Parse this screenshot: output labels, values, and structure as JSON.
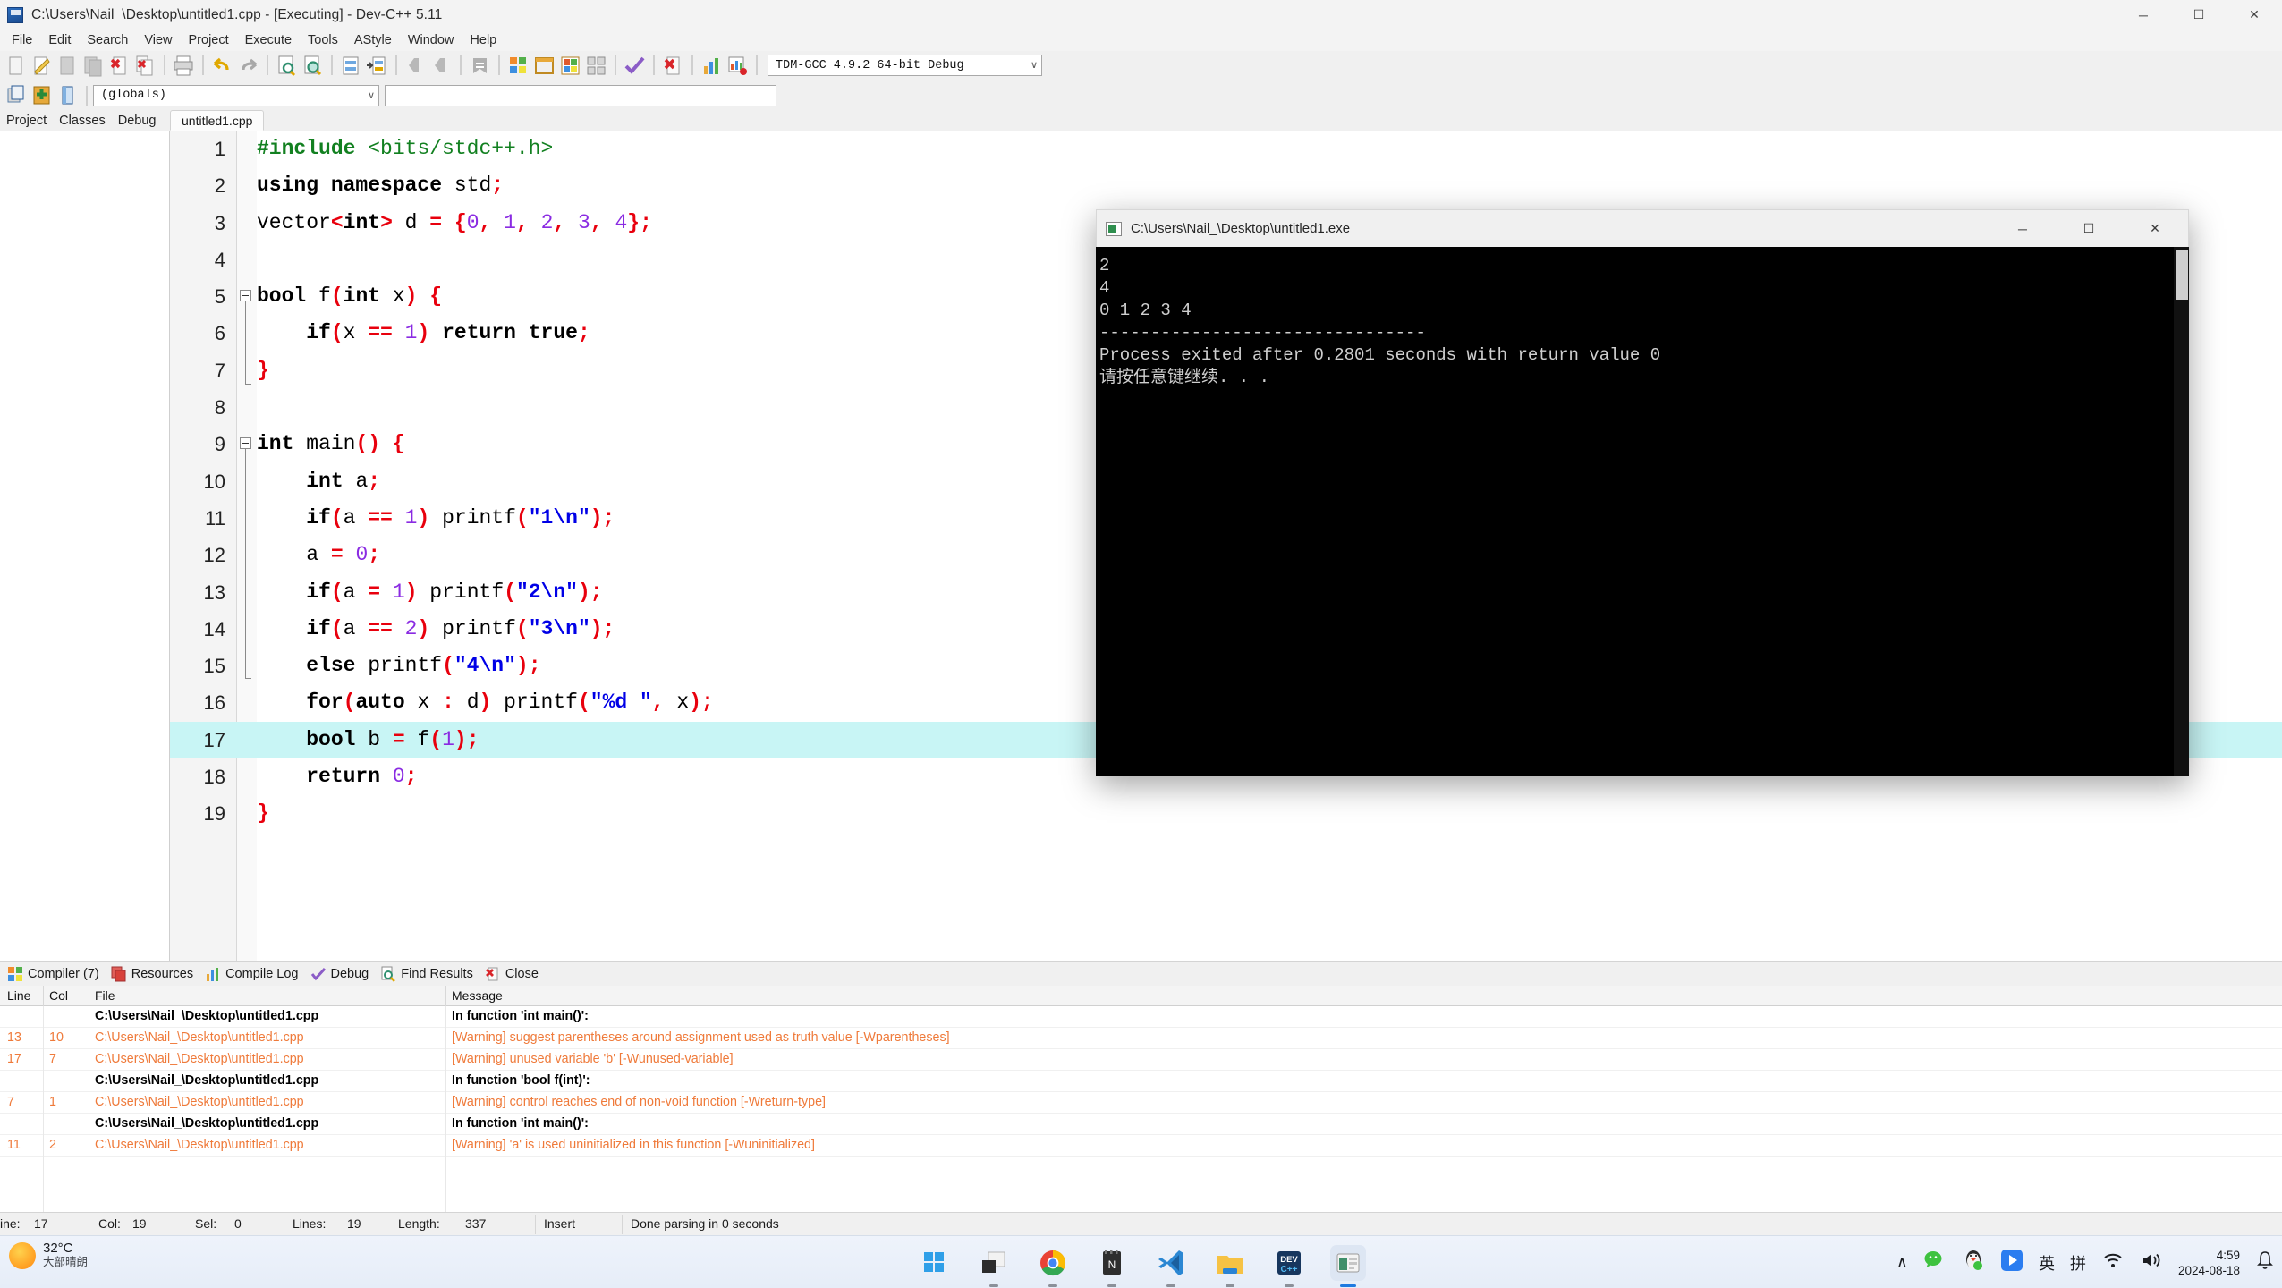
{
  "window": {
    "title": "C:\\Users\\Nail_\\Desktop\\untitled1.cpp - [Executing] - Dev-C++ 5.11",
    "minimize": "─",
    "maximize": "☐",
    "close": "✕"
  },
  "menu": [
    {
      "label": "File"
    },
    {
      "label": "Edit"
    },
    {
      "label": "Search"
    },
    {
      "label": "View"
    },
    {
      "label": "Project"
    },
    {
      "label": "Execute"
    },
    {
      "label": "Tools"
    },
    {
      "label": "AStyle"
    },
    {
      "label": "Window"
    },
    {
      "label": "Help"
    }
  ],
  "toolbar": {
    "compiler_set": "TDM-GCC 4.9.2 64-bit Debug",
    "chevron": "∨",
    "scope": "(globals)"
  },
  "left_panel": {
    "tabs": [
      "Project",
      "Classes",
      "Debug"
    ]
  },
  "editor": {
    "file_tab": "untitled1.cpp",
    "active_line": 17,
    "lines": [
      {
        "n": 1,
        "tokens": [
          {
            "t": "#include",
            "c": "pp"
          },
          {
            "t": " ",
            "c": "id"
          },
          {
            "t": "<bits/stdc++.h>",
            "c": "ppv"
          }
        ]
      },
      {
        "n": 2,
        "tokens": [
          {
            "t": "using namespace",
            "c": "k"
          },
          {
            "t": " std",
            "c": "id"
          },
          {
            "t": ";",
            "c": "op"
          }
        ]
      },
      {
        "n": 3,
        "tokens": [
          {
            "t": "vector",
            "c": "id"
          },
          {
            "t": "<",
            "c": "op"
          },
          {
            "t": "int",
            "c": "k"
          },
          {
            "t": ">",
            "c": "op"
          },
          {
            "t": " d ",
            "c": "id"
          },
          {
            "t": "=",
            "c": "op"
          },
          {
            "t": " ",
            "c": "id"
          },
          {
            "t": "{",
            "c": "op"
          },
          {
            "t": "0",
            "c": "nu"
          },
          {
            "t": ",",
            "c": "op"
          },
          {
            "t": " ",
            "c": "id"
          },
          {
            "t": "1",
            "c": "nu"
          },
          {
            "t": ",",
            "c": "op"
          },
          {
            "t": " ",
            "c": "id"
          },
          {
            "t": "2",
            "c": "nu"
          },
          {
            "t": ",",
            "c": "op"
          },
          {
            "t": " ",
            "c": "id"
          },
          {
            "t": "3",
            "c": "nu"
          },
          {
            "t": ",",
            "c": "op"
          },
          {
            "t": " ",
            "c": "id"
          },
          {
            "t": "4",
            "c": "nu"
          },
          {
            "t": "};",
            "c": "op"
          }
        ]
      },
      {
        "n": 4,
        "tokens": []
      },
      {
        "n": 5,
        "tokens": [
          {
            "t": "bool",
            "c": "k"
          },
          {
            "t": " f",
            "c": "id"
          },
          {
            "t": "(",
            "c": "op"
          },
          {
            "t": "int",
            "c": "k"
          },
          {
            "t": " x",
            "c": "id"
          },
          {
            "t": ") {",
            "c": "op"
          }
        ]
      },
      {
        "n": 6,
        "tokens": [
          {
            "t": "    ",
            "c": "id"
          },
          {
            "t": "if",
            "c": "k"
          },
          {
            "t": "(",
            "c": "op"
          },
          {
            "t": "x ",
            "c": "id"
          },
          {
            "t": "==",
            "c": "op"
          },
          {
            "t": " ",
            "c": "id"
          },
          {
            "t": "1",
            "c": "nu"
          },
          {
            "t": ")",
            "c": "op"
          },
          {
            "t": " ",
            "c": "id"
          },
          {
            "t": "return",
            "c": "k"
          },
          {
            "t": " ",
            "c": "id"
          },
          {
            "t": "true",
            "c": "k"
          },
          {
            "t": ";",
            "c": "op"
          }
        ]
      },
      {
        "n": 7,
        "tokens": [
          {
            "t": "}",
            "c": "op"
          }
        ]
      },
      {
        "n": 8,
        "tokens": []
      },
      {
        "n": 9,
        "tokens": [
          {
            "t": "int",
            "c": "k"
          },
          {
            "t": " main",
            "c": "id"
          },
          {
            "t": "() {",
            "c": "op"
          }
        ]
      },
      {
        "n": 10,
        "tokens": [
          {
            "t": "    ",
            "c": "id"
          },
          {
            "t": "int",
            "c": "k"
          },
          {
            "t": " a",
            "c": "id"
          },
          {
            "t": ";",
            "c": "op"
          }
        ]
      },
      {
        "n": 11,
        "tokens": [
          {
            "t": "    ",
            "c": "id"
          },
          {
            "t": "if",
            "c": "k"
          },
          {
            "t": "(",
            "c": "op"
          },
          {
            "t": "a ",
            "c": "id"
          },
          {
            "t": "==",
            "c": "op"
          },
          {
            "t": " ",
            "c": "id"
          },
          {
            "t": "1",
            "c": "nu"
          },
          {
            "t": ")",
            "c": "op"
          },
          {
            "t": " printf",
            "c": "id"
          },
          {
            "t": "(",
            "c": "op"
          },
          {
            "t": "\"1\\n\"",
            "c": "st"
          },
          {
            "t": ");",
            "c": "op"
          }
        ]
      },
      {
        "n": 12,
        "tokens": [
          {
            "t": "    a ",
            "c": "id"
          },
          {
            "t": "=",
            "c": "op"
          },
          {
            "t": " ",
            "c": "id"
          },
          {
            "t": "0",
            "c": "nu"
          },
          {
            "t": ";",
            "c": "op"
          }
        ]
      },
      {
        "n": 13,
        "tokens": [
          {
            "t": "    ",
            "c": "id"
          },
          {
            "t": "if",
            "c": "k"
          },
          {
            "t": "(",
            "c": "op"
          },
          {
            "t": "a ",
            "c": "id"
          },
          {
            "t": "=",
            "c": "op"
          },
          {
            "t": " ",
            "c": "id"
          },
          {
            "t": "1",
            "c": "nu"
          },
          {
            "t": ")",
            "c": "op"
          },
          {
            "t": " printf",
            "c": "id"
          },
          {
            "t": "(",
            "c": "op"
          },
          {
            "t": "\"2\\n\"",
            "c": "st"
          },
          {
            "t": ");",
            "c": "op"
          }
        ]
      },
      {
        "n": 14,
        "tokens": [
          {
            "t": "    ",
            "c": "id"
          },
          {
            "t": "if",
            "c": "k"
          },
          {
            "t": "(",
            "c": "op"
          },
          {
            "t": "a ",
            "c": "id"
          },
          {
            "t": "==",
            "c": "op"
          },
          {
            "t": " ",
            "c": "id"
          },
          {
            "t": "2",
            "c": "nu"
          },
          {
            "t": ")",
            "c": "op"
          },
          {
            "t": " printf",
            "c": "id"
          },
          {
            "t": "(",
            "c": "op"
          },
          {
            "t": "\"3\\n\"",
            "c": "st"
          },
          {
            "t": ");",
            "c": "op"
          }
        ]
      },
      {
        "n": 15,
        "tokens": [
          {
            "t": "    ",
            "c": "id"
          },
          {
            "t": "else",
            "c": "k"
          },
          {
            "t": " printf",
            "c": "id"
          },
          {
            "t": "(",
            "c": "op"
          },
          {
            "t": "\"4\\n\"",
            "c": "st"
          },
          {
            "t": ");",
            "c": "op"
          }
        ]
      },
      {
        "n": 16,
        "tokens": [
          {
            "t": "    ",
            "c": "id"
          },
          {
            "t": "for",
            "c": "k"
          },
          {
            "t": "(",
            "c": "op"
          },
          {
            "t": "auto",
            "c": "k"
          },
          {
            "t": " x ",
            "c": "id"
          },
          {
            "t": ":",
            "c": "op"
          },
          {
            "t": " d",
            "c": "id"
          },
          {
            "t": ")",
            "c": "op"
          },
          {
            "t": " printf",
            "c": "id"
          },
          {
            "t": "(",
            "c": "op"
          },
          {
            "t": "\"%d \"",
            "c": "st"
          },
          {
            "t": ",",
            "c": "op"
          },
          {
            "t": " x",
            "c": "id"
          },
          {
            "t": ");",
            "c": "op"
          }
        ]
      },
      {
        "n": 17,
        "tokens": [
          {
            "t": "    ",
            "c": "id"
          },
          {
            "t": "bool",
            "c": "k"
          },
          {
            "t": " b ",
            "c": "id"
          },
          {
            "t": "=",
            "c": "op"
          },
          {
            "t": " f",
            "c": "id"
          },
          {
            "t": "(",
            "c": "op"
          },
          {
            "t": "1",
            "c": "nu"
          },
          {
            "t": ");",
            "c": "op"
          }
        ]
      },
      {
        "n": 18,
        "tokens": [
          {
            "t": "    ",
            "c": "id"
          },
          {
            "t": "return",
            "c": "k"
          },
          {
            "t": " ",
            "c": "id"
          },
          {
            "t": "0",
            "c": "nu"
          },
          {
            "t": ";",
            "c": "op"
          }
        ]
      },
      {
        "n": 19,
        "tokens": [
          {
            "t": "}",
            "c": "op"
          }
        ]
      }
    ]
  },
  "console": {
    "title": "C:\\Users\\Nail_\\Desktop\\untitled1.exe",
    "minimize": "─",
    "maximize": "☐",
    "close": "✕",
    "output": [
      "2",
      "4",
      "0 1 2 3 4",
      "--------------------------------",
      "Process exited after 0.2801 seconds with return value 0",
      "请按任意键继续. . ."
    ]
  },
  "message_panel": {
    "tabs": [
      {
        "label": "Compiler (7)",
        "icon": "grid-icon"
      },
      {
        "label": "Resources",
        "icon": "layers-icon"
      },
      {
        "label": "Compile Log",
        "icon": "bars-icon"
      },
      {
        "label": "Debug",
        "icon": "check-icon"
      },
      {
        "label": "Find Results",
        "icon": "magnifier-icon"
      },
      {
        "label": "Close",
        "icon": "close-red-icon"
      }
    ],
    "columns": [
      "Line",
      "Col",
      "File",
      "Message"
    ],
    "rows": [
      {
        "line": "",
        "col": "",
        "file": "C:\\Users\\Nail_\\Desktop\\untitled1.cpp",
        "message": "In function 'int main()':",
        "kind": "bold"
      },
      {
        "line": "13",
        "col": "10",
        "file": "C:\\Users\\Nail_\\Desktop\\untitled1.cpp",
        "message": "[Warning] suggest parentheses around assignment used as truth value [-Wparentheses]",
        "kind": "warn"
      },
      {
        "line": "17",
        "col": "7",
        "file": "C:\\Users\\Nail_\\Desktop\\untitled1.cpp",
        "message": "[Warning] unused variable 'b' [-Wunused-variable]",
        "kind": "warn"
      },
      {
        "line": "",
        "col": "",
        "file": "C:\\Users\\Nail_\\Desktop\\untitled1.cpp",
        "message": "In function 'bool f(int)':",
        "kind": "bold"
      },
      {
        "line": "7",
        "col": "1",
        "file": "C:\\Users\\Nail_\\Desktop\\untitled1.cpp",
        "message": "[Warning] control reaches end of non-void function [-Wreturn-type]",
        "kind": "warn"
      },
      {
        "line": "",
        "col": "",
        "file": "C:\\Users\\Nail_\\Desktop\\untitled1.cpp",
        "message": "In function 'int main()':",
        "kind": "bold"
      },
      {
        "line": "11",
        "col": "2",
        "file": "C:\\Users\\Nail_\\Desktop\\untitled1.cpp",
        "message": "[Warning] 'a' is used uninitialized in this function [-Wuninitialized]",
        "kind": "warn"
      }
    ]
  },
  "status_bar": {
    "line_label": "ine:",
    "line_value": "17",
    "col_label": "Col:",
    "col_value": "19",
    "sel_label": "Sel:",
    "sel_value": "0",
    "lines_label": "Lines:",
    "lines_value": "19",
    "length_label": "Length:",
    "length_value": "337",
    "mode": "Insert",
    "parse_status": "Done parsing in 0 seconds"
  },
  "taskbar": {
    "weather_temp": "32°C",
    "weather_desc": "大部晴朗",
    "apps": [
      {
        "name": "start-button"
      },
      {
        "name": "task-view-button"
      },
      {
        "name": "chrome-icon"
      },
      {
        "name": "notepad-icon"
      },
      {
        "name": "vscode-icon"
      },
      {
        "name": "file-explorer-icon"
      },
      {
        "name": "devcpp-icon"
      },
      {
        "name": "devcpp-window-icon"
      }
    ],
    "tray": {
      "chevron": "∧",
      "ime_lang": "英",
      "ime_mode": "拼",
      "time": "4:59",
      "date": "2024-08-18",
      "bell": "ὑ4"
    }
  },
  "colors": {
    "accent": "#1f7ae0",
    "warning": "#ef7a3a",
    "highlight": "#c8f5f5",
    "keyword": "#000000",
    "string": "#0000e6",
    "number": "#8a2be2",
    "operator": "#e8000d",
    "preproc": "#128020"
  }
}
